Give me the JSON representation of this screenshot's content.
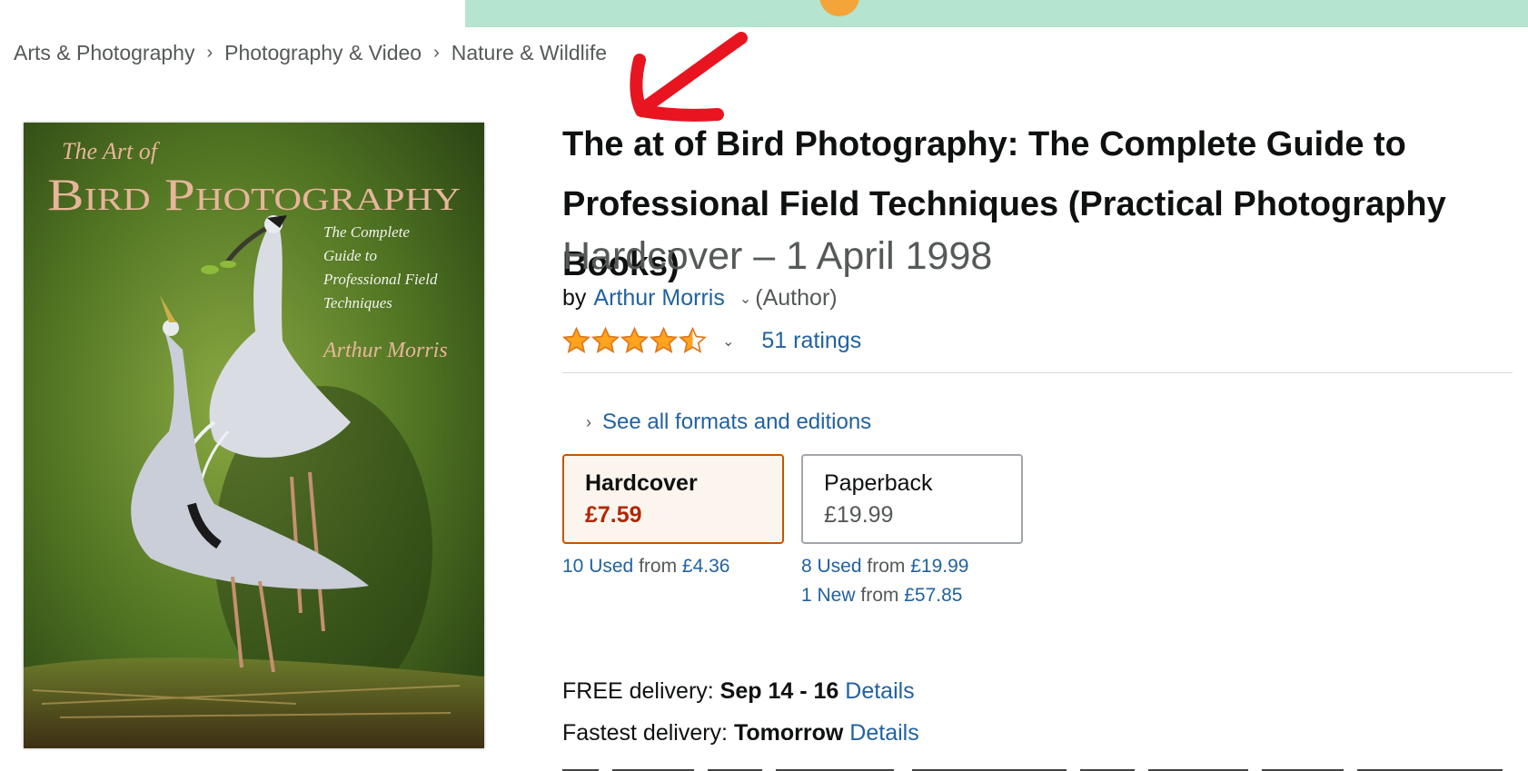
{
  "breadcrumb": [
    "Arts & Photography",
    "Photography & Video",
    "Nature & Wildlife"
  ],
  "cover": {
    "title_small": "The Art of",
    "title_large": "Bird Photography",
    "subtitle": [
      "The Complete",
      "Guide to",
      "Professional Field",
      "Techniques"
    ],
    "author": "Arthur Morris"
  },
  "product": {
    "title": "The at of Bird Photography: The Complete Guide to Professional Field Techniques (Practical Photography Books)",
    "format_date": "Hardcover – 1 April 1998",
    "by_label": "by",
    "author": "Arthur Morris",
    "author_role": "(Author)",
    "rating": 4.5,
    "ratings_count": "51 ratings"
  },
  "formats": {
    "see_all": "See all formats and editions",
    "hardcover": {
      "name": "Hardcover",
      "price": "£7.59",
      "used_link": "10 Used",
      "used_from": "from",
      "used_price": "£4.36"
    },
    "paperback": {
      "name": "Paperback",
      "price": "£19.99",
      "used_link": "8 Used",
      "used_from": "from",
      "used_price": "£19.99",
      "new_link": "1 New",
      "new_from": "from",
      "new_price": "£57.85"
    }
  },
  "delivery": {
    "free_label": "FREE delivery:",
    "free_date": "Sep 14 - 16",
    "free_details": "Details",
    "fast_label": "Fastest delivery:",
    "fast_date": "Tomorrow",
    "fast_details": "Details"
  },
  "colors": {
    "link": "#2162a1",
    "price": "#b12704",
    "selected_border": "#c45500",
    "annotation_arrow": "#e8141f",
    "star": "#ffa41c"
  }
}
